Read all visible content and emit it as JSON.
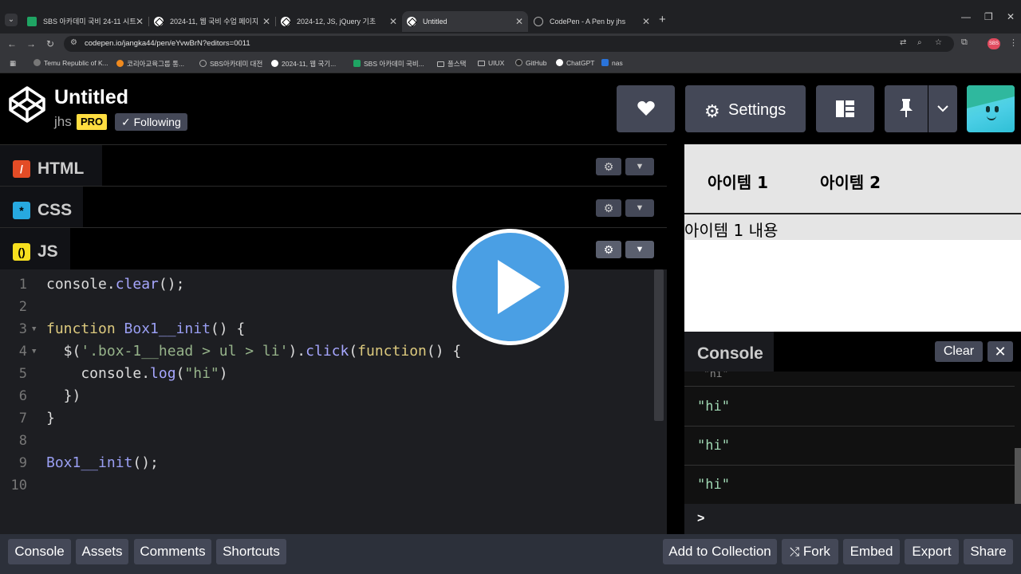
{
  "browser": {
    "tabs": [
      {
        "label": "SBS 아카데미 국비 24-11 시트",
        "icon": "sheets-icon",
        "active": false
      },
      {
        "label": "2024-11, 웹 국비 수업 페이지",
        "icon": "codepen-icon",
        "active": false
      },
      {
        "label": "2024-12, JS, jQuery 기초",
        "icon": "codepen-icon",
        "active": false
      },
      {
        "label": "Untitled",
        "icon": "codepen-icon",
        "active": true
      },
      {
        "label": "CodePen - A Pen by jhs",
        "icon": "globe-icon",
        "active": false
      }
    ],
    "url": "codepen.io/jangka44/pen/eYvwBrN?editors=0011",
    "bookmarks": [
      {
        "label": "Temu Republic of K...",
        "icon": "temu"
      },
      {
        "label": "코리아교육그룹 통...",
        "icon": "orange"
      },
      {
        "label": "SBS아카데미 대전",
        "icon": "globe"
      },
      {
        "label": "2024-11, 웹 국기...",
        "icon": "cp"
      },
      {
        "label": "SBS 아카데미 국비...",
        "icon": "sheet"
      },
      {
        "label": "풀스택",
        "icon": "folder"
      },
      {
        "label": "UIUX",
        "icon": "folder"
      },
      {
        "label": "GitHub",
        "icon": "gh"
      },
      {
        "label": "ChatGPT",
        "icon": "gpt"
      },
      {
        "label": "nas",
        "icon": "nas"
      }
    ],
    "profile_badge": "SBS"
  },
  "header": {
    "title": "Untitled",
    "author": "jhs",
    "pro_badge": "PRO",
    "following_label": "✓ Following",
    "settings_label": "Settings"
  },
  "editors": {
    "html_label": "HTML",
    "css_label": "CSS",
    "js_label": "JS",
    "colors": {
      "html": "#e34c26",
      "css": "#27a9e0",
      "js": "#f7df1e"
    }
  },
  "code": {
    "line_numbers": [
      "1",
      "2",
      "3",
      "4",
      "5",
      "6",
      "7",
      "8",
      "9",
      "10"
    ]
  },
  "preview": {
    "items": [
      "아이템 1",
      "아이템 2"
    ],
    "content": "아이템 1 내용"
  },
  "console": {
    "title": "Console",
    "clear_label": "Clear",
    "partial_line": "\"hi\"",
    "logs": [
      "\"hi\"",
      "\"hi\"",
      "\"hi\""
    ],
    "prompt": ">"
  },
  "footer": {
    "left": [
      "Console",
      "Assets",
      "Comments",
      "Shortcuts"
    ],
    "add_to_collection": "Add to Collection",
    "fork": "Fork",
    "embed": "Embed",
    "export": "Export",
    "share": "Share"
  }
}
